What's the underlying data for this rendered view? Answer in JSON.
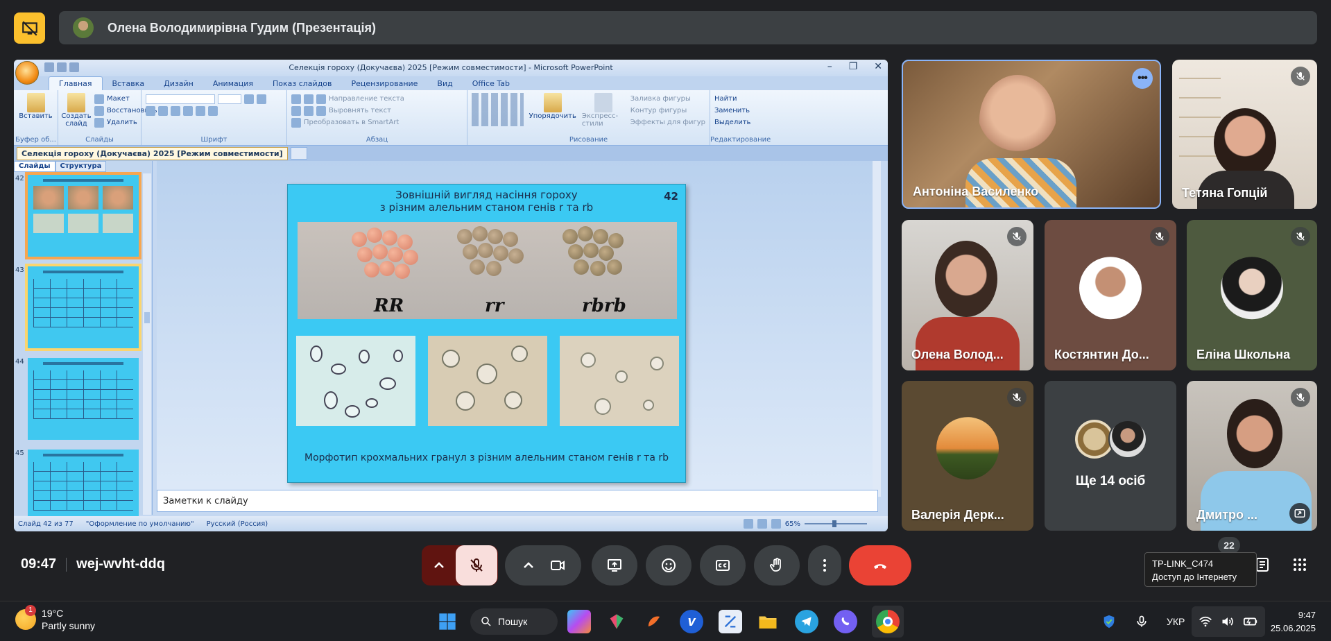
{
  "meet": {
    "presenter_name": "Олена Володимирівна Гудим (Презентація)",
    "time": "09:47",
    "meeting_code": "wej-wvht-ddq",
    "chat_badge": "22",
    "tooltip_ssid": "TP-LINK_C474",
    "tooltip_status": "Доступ до Інтернету"
  },
  "participants": [
    {
      "name": "Антоніна Василенко",
      "muted": false,
      "active_speaker": true
    },
    {
      "name": "Тетяна Гопцій",
      "muted": true
    },
    {
      "name": "Олена Волод...",
      "muted": true
    },
    {
      "name": "Костянтин До...",
      "muted": true
    },
    {
      "name": "Еліна Школьна",
      "muted": true
    },
    {
      "name": "Валерія Дерк...",
      "muted": true
    },
    {
      "name": "Ще 14 осіб",
      "muted": false
    },
    {
      "name": "Дмитро ...",
      "muted": true
    }
  ],
  "powerpoint": {
    "window_title": "Селекція гороху (Докучаєва) 2025 [Режим совместимости] - Microsoft PowerPoint",
    "tabs": [
      "Главная",
      "Вставка",
      "Дизайн",
      "Анимация",
      "Показ слайдов",
      "Рецензирование",
      "Вид",
      "Office Tab"
    ],
    "groups": {
      "clipboard": "Буфер об...",
      "slides": "Слайды",
      "font": "Шрифт",
      "paragraph": "Абзац",
      "drawing": "Рисование",
      "editing": "Редактирование"
    },
    "ribbon": {
      "paste": "Вставить",
      "new_slide": "Создать слайд",
      "layout": "Макет",
      "reset": "Восстановить",
      "delete": "Удалить",
      "text_direction": "Направление текста",
      "align_text": "Выровнять текст",
      "smartart": "Преобразовать в SmartArt",
      "arrange": "Упорядочить",
      "quick_styles": "Экспресс-стили",
      "shape_fill": "Заливка фигуры",
      "shape_outline": "Контур фигуры",
      "shape_effects": "Эффекты для фигур",
      "find": "Найти",
      "replace": "Заменить",
      "select": "Выделить"
    },
    "doc_tab": "Селекція гороху (Докучаєва) 2025 [Режим совместимости]",
    "pane_tabs": [
      "Слайды",
      "Структура"
    ],
    "thumb_numbers": [
      "42",
      "43",
      "44",
      "45"
    ],
    "slide": {
      "title_line1": "Зовнішній вигляд насіння гороху",
      "title_line2": "з різним алельним станом генів r та rb",
      "number": "42",
      "labels": [
        "RR",
        "rr",
        "rbrb"
      ],
      "caption": "Морфотип крохмальних гранул з різним алельним станом генів  r   та rb"
    },
    "notes_placeholder": "Заметки к слайду",
    "status": {
      "slide_of": "Слайд 42 из 77",
      "theme": "\"Оформление по умолчанию\"",
      "language": "Русский (Россия)",
      "zoom": "65%"
    }
  },
  "taskbar": {
    "weather_temp": "19°C",
    "weather_desc": "Partly sunny",
    "weather_badge": "1",
    "search_label": "Пошук",
    "language": "УКР",
    "clock_time": "9:47",
    "clock_date": "25.06.2025"
  },
  "colors": {
    "accent_yellow": "#fbc02d",
    "end_call": "#ea4335",
    "mic_muted_bg": "#f9dedc",
    "slide_bg": "#3bc9f3"
  }
}
